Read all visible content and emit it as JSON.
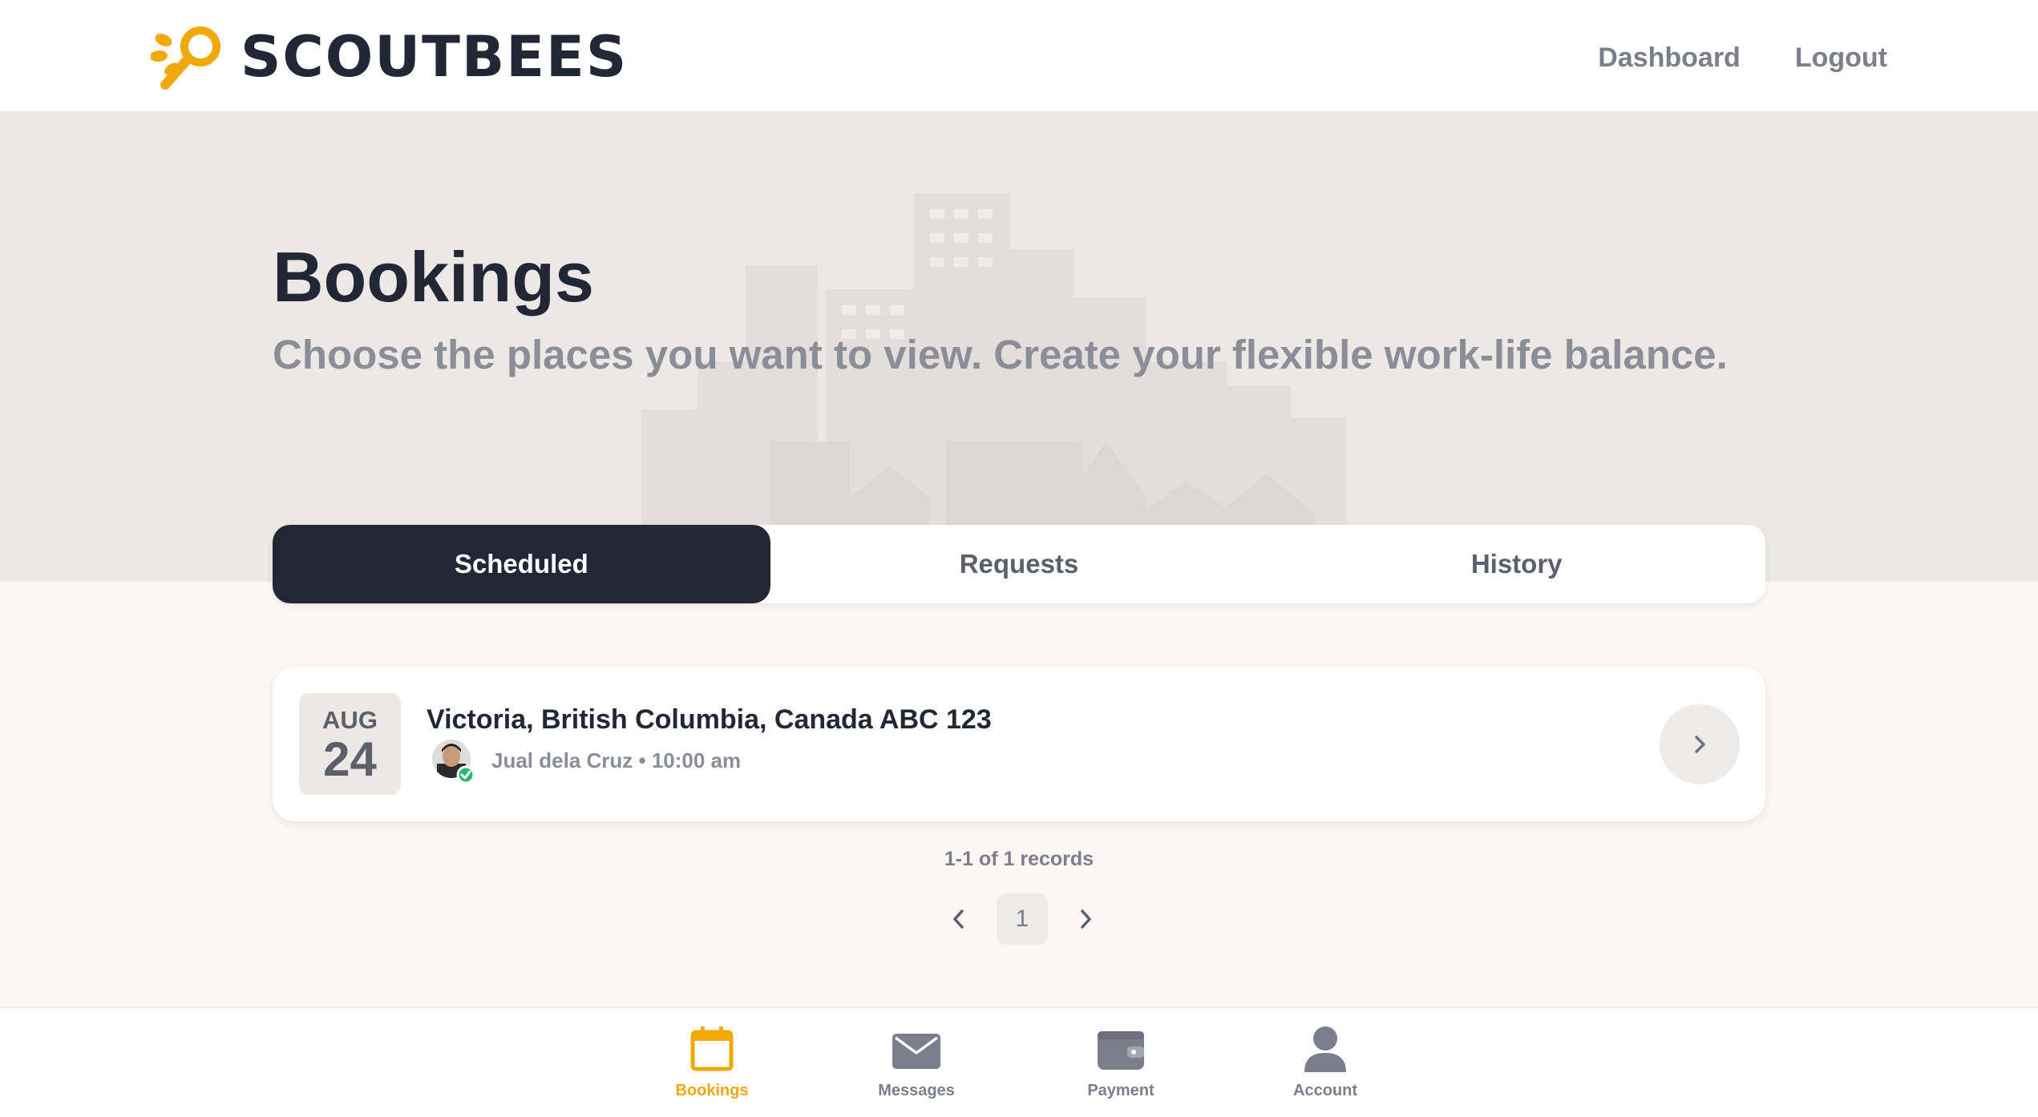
{
  "header": {
    "brand": "SCOUTBEES",
    "nav": [
      {
        "label": "Dashboard"
      },
      {
        "label": "Logout"
      }
    ]
  },
  "hero": {
    "title": "Bookings",
    "subtitle": "Choose the places you want to view. Create your flexible work-life balance."
  },
  "tabs": [
    {
      "label": "Scheduled",
      "active": true
    },
    {
      "label": "Requests",
      "active": false
    },
    {
      "label": "History",
      "active": false
    }
  ],
  "bookings": [
    {
      "month": "AUG",
      "day": "24",
      "address": "Victoria, British Columbia, Canada ABC 123",
      "meta": "Jual dela Cruz • 10:00 am",
      "verified": true
    }
  ],
  "pagination": {
    "records_text": "1-1 of 1 records",
    "current_page": "1"
  },
  "bottom_nav": [
    {
      "label": "Bookings",
      "icon": "calendar-icon",
      "active": true
    },
    {
      "label": "Messages",
      "icon": "envelope-icon",
      "active": false
    },
    {
      "label": "Payment",
      "icon": "wallet-icon",
      "active": false
    },
    {
      "label": "Account",
      "icon": "user-icon",
      "active": false
    }
  ],
  "colors": {
    "accent": "#f0a909",
    "dark": "#222736",
    "hero_bg": "#ece8e5",
    "page_bg": "#fdf6f4",
    "verified": "#2bb673"
  }
}
